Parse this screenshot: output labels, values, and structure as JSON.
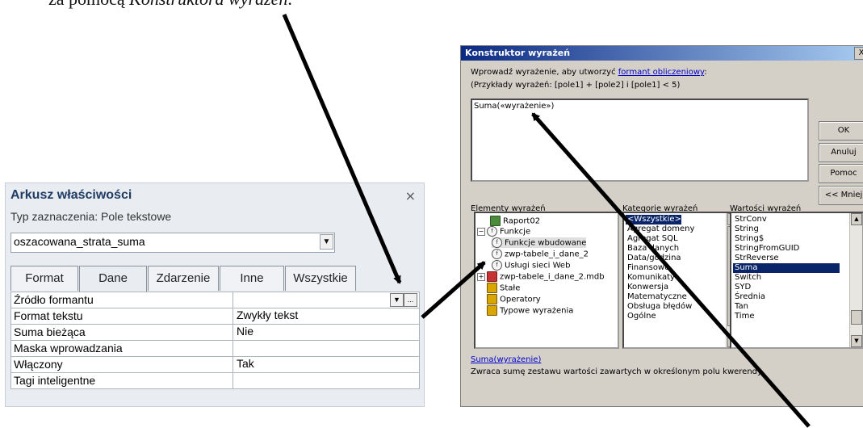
{
  "caption": {
    "text_before": "za pomocą ",
    "text_italic": "Konstruktora wyrażeń",
    "text_after": "."
  },
  "property_sheet": {
    "title": "Arkusz właściwości",
    "close": "×",
    "selection_type": "Typ zaznaczenia:  Pole tekstowe",
    "combo_value": "oszacowana_strata_suma",
    "tabs": [
      "Format",
      "Dane",
      "Zdarzenie",
      "Inne",
      "Wszystkie"
    ],
    "active_tab": "Dane",
    "rows": [
      {
        "name": "Źródło formantu",
        "value": ""
      },
      {
        "name": "Format tekstu",
        "value": "Zwykły tekst"
      },
      {
        "name": "Suma bieżąca",
        "value": "Nie"
      },
      {
        "name": "Maska wprowadzania",
        "value": ""
      },
      {
        "name": "Włączony",
        "value": "Tak"
      },
      {
        "name": "Tagi inteligentne",
        "value": ""
      }
    ],
    "builder_button": "..."
  },
  "expression_builder": {
    "title": "Konstruktor wyrażeń",
    "close": "X",
    "instruction_prefix": "Wprowadź wyrażenie, aby utworzyć ",
    "instruction_link": "formant obliczeniowy",
    "instruction_suffix": ":",
    "example": "(Przykłady wyrażeń: [pole1] + [pole2] i [pole1] < 5)",
    "expression": "Suma(«wyrażenie»)",
    "buttons": {
      "ok": "OK",
      "cancel": "Anuluj",
      "help": "Pomoc",
      "less": "<< Mniej"
    },
    "elements_label": "Elementy wyrażeń",
    "categories_label": "Kategorie wyrażeń",
    "values_label": "Wartości wyrażeń",
    "tree": [
      {
        "label": "Raport02",
        "icon": "report-icon"
      },
      {
        "label": "Funkcje",
        "icon": "function-icon"
      },
      {
        "label": "Funkcje wbudowane",
        "icon": "function-icon"
      },
      {
        "label": "zwp-tabele_i_dane_2",
        "icon": "function-icon"
      },
      {
        "label": "Usługi sieci Web",
        "icon": "function-icon"
      },
      {
        "label": "zwp-tabele_i_dane_2.mdb",
        "icon": "database-icon"
      },
      {
        "label": "Stałe",
        "icon": "constants-icon"
      },
      {
        "label": "Operatory",
        "icon": "operators-icon"
      },
      {
        "label": "Typowe wyrażenia",
        "icon": "expressions-icon"
      }
    ],
    "categories": [
      "<Wszystkie>",
      "Agregat domeny",
      "Agregat SQL",
      "Baza danych",
      "Data/godzina",
      "Finansowe",
      "Komunikaty",
      "Konwersja",
      "Matematyczne",
      "Obsługa błędów",
      "Ogólne"
    ],
    "selected_category": "<Wszystkie>",
    "values": [
      "StrConv",
      "String",
      "String$",
      "StringFromGUID",
      "StrReverse",
      "Suma",
      "Switch",
      "SYD",
      "Średnia",
      "Tan",
      "Time"
    ],
    "selected_value": "Suma",
    "description_link": "Suma(wyrażenie)",
    "description": "Zwraca sumę zestawu wartości zawartych w określonym polu kwerendy."
  }
}
